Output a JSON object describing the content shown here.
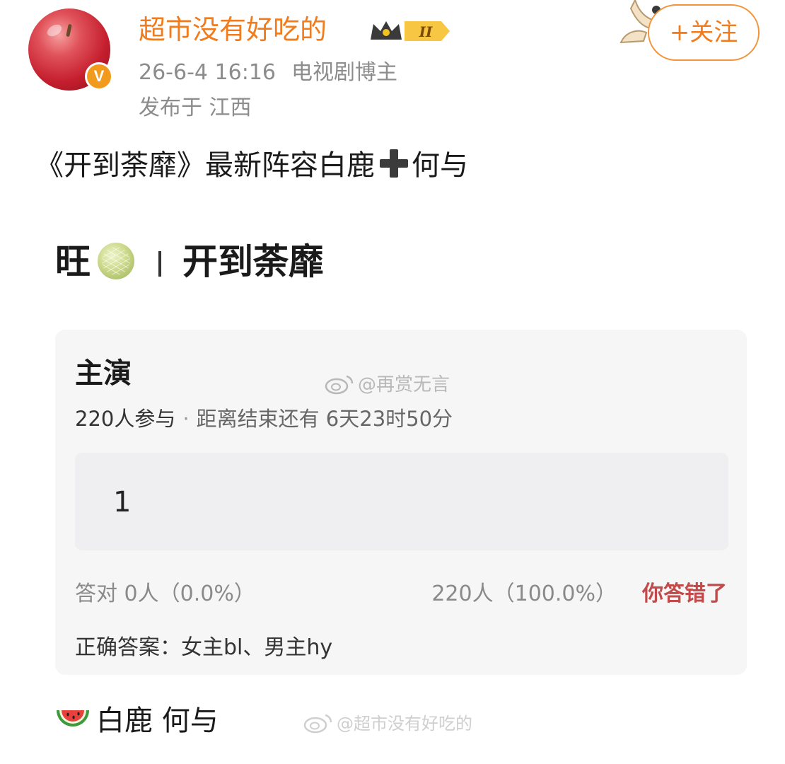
{
  "header": {
    "username": "超市没有好吃的",
    "level_badge": "II",
    "date": "26-6-4 16:16",
    "user_type": "电视剧博主",
    "location": "发布于 江西",
    "follow_label": "+关注",
    "verified_mark": "V"
  },
  "post": {
    "text_before": "《开到荼靡》最新阵容白鹿",
    "text_after": "何与"
  },
  "screenshot": {
    "title_prefix": "旺",
    "title_name": "开到荼靡",
    "quiz": {
      "heading": "主演",
      "participants": "220人参与",
      "remaining": "距离结束还有 6天23时50分",
      "option_value": "1",
      "correct_stat": "答对 0人（0.0%）",
      "wrong_stat": "220人（100.0%）",
      "wrong_label": "你答错了",
      "answer": "正确答案：女主bl、男主hy"
    },
    "cast": "白鹿 何与"
  },
  "watermarks": {
    "top": "@再赏无言",
    "bottom": "@超市没有好吃的"
  },
  "colors": {
    "username": "#f07c1d",
    "follow_border": "#f2943a",
    "wrong": "#c24a4a",
    "card_bg": "#f6f6f7"
  },
  "icons": {
    "plus": "plus-icon",
    "melon": "melon-icon",
    "watermelon": "watermelon-icon",
    "weibo": "weibo-logo-icon",
    "crown": "crown-icon"
  }
}
